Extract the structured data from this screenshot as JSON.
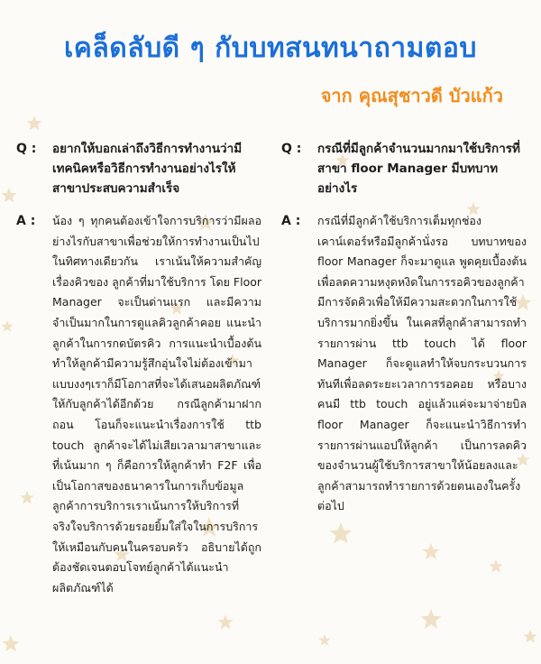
{
  "header": {
    "title": "เคล็ดลับดี ๆ กับบทสนทนาถามตอบ",
    "subtitle": "จาก คุณสุชาวดี  บัวแก้ว"
  },
  "labels": {
    "q": "Q :",
    "a": "A :"
  },
  "left": {
    "question": "อยากให้บอกเล่าถึงวิธีการทำงานว่ามีเทคนิคหรือวิธีการทำงานอย่างไรให้สาขาประสบความสำเร็จ",
    "answer": "น้อง ๆ ทุกคนต้องเข้าใจการบริการว่ามีผลอย่างไรกับสาขาเพื่อช่วยให้การทำงานเป็นไปในทิศทางเดียวกัน เราเน้นให้ความสำคัญเรื่องคิวของ ลูกค้าที่มาใช้บริการ โดย Floor Manager จะเป็นด่านแรก และมีความจำเป็นมากในการดูแลคิวลูกค้าคอย แนะนำลูกค้าในการกดบัตรคิว การแนะนำเบื้องต้นทำให้ลูกค้ามีความรู้สึกอุ่นใจไม่ต้องเข้ามาแบบงงๆเราก็มีโอกาสที่จะได้เสนอผลิตภัณฑ์ให้กับลูกค้าได้อีกด้วย กรณีลูกค้ามาฝาก ถอน โอนก็จะแนะนำเรื่องการใช้ ttb touch ลูกค้าจะได้ไม่เสียเวลามาสาขาและที่เน้นมาก ๆ ก็คือการให้ลูกค้าทำ F2F เพื่อเป็นโอกาสของธนาคารในการเก็บข้อมูลลูกค้าการบริการเราเน้นการให้บริการที่จริงใจบริการด้วยรอยยิ้มใส่ใจในการบริการให้เหมือนกับคนในครอบครัว อธิบายได้ถูกต้องชัดเจนตอบโจทย์ลูกค้าได้แนะนำผลิตภัณฑ์ได้"
  },
  "right": {
    "question": "กรณีที่มีลูกค้าจำนวนมากมาใช้บริการที่สาขา floor Manager มีบทบาทอย่างไร",
    "answer": "กรณีที่มีลูกค้าใช้บริการเต็มทุกช่องเคาน์เตอร์หรือมีลูกค้านั่งรอ บทบาทของ floor Manager ก็จะมาดูแล พูดคุยเบื้องต้นเพื่อลดความหงุดหงิดในการรอคิวของลูกค้า มีการจัดคิวเพื่อให้มีความสะดวกในการใช้บริการมากยิ่งขึ้น ในเคสที่ลูกค้าสามารถทำรายการผ่าน ttb touch ได้ floor Manager ก็จะดูแลทำให้จบกระบวนการทันทีเพื่อลดระยะเวลาการรอคอย หรือบางคนมี ttb touch อยู่แล้วแค่จะมาจ่ายบิล floor Manager ก็จะแนะนำวิธีการทำรายการผ่านแอปให้ลูกค้า เป็นการลดคิวของจำนวนผู้ใช้บริการสาขาให้น้อยลงและลูกค้าสามารถทำรายการด้วยตนเองในครั้งต่อไป"
  }
}
